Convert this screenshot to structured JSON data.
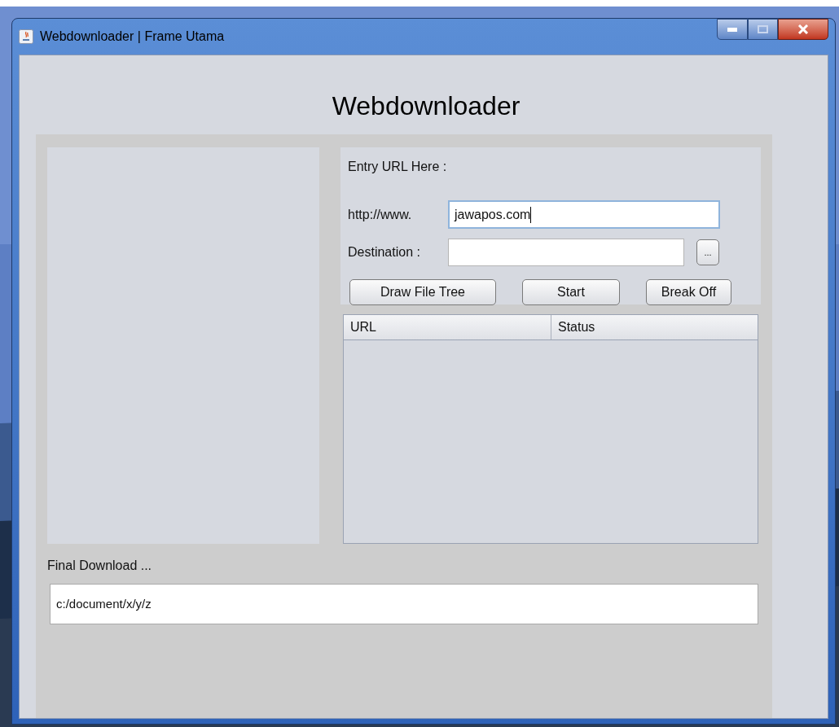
{
  "window": {
    "title": "Webdownloader | Frame Utama"
  },
  "heading": "Webdownloader",
  "entry_label": "Entry URL Here :",
  "url_field": {
    "label": "http://www.",
    "value": "jawapos.com",
    "focused": true
  },
  "destination_field": {
    "label": "Destination :",
    "browse_button": "..."
  },
  "buttons": [
    "Draw File Tree",
    "Start",
    "Break Off"
  ],
  "table": {
    "columns": [
      "URL",
      "Status"
    ]
  },
  "final_download": {
    "label": "Final Download ...",
    "value": "c:/document/x/y/z"
  }
}
